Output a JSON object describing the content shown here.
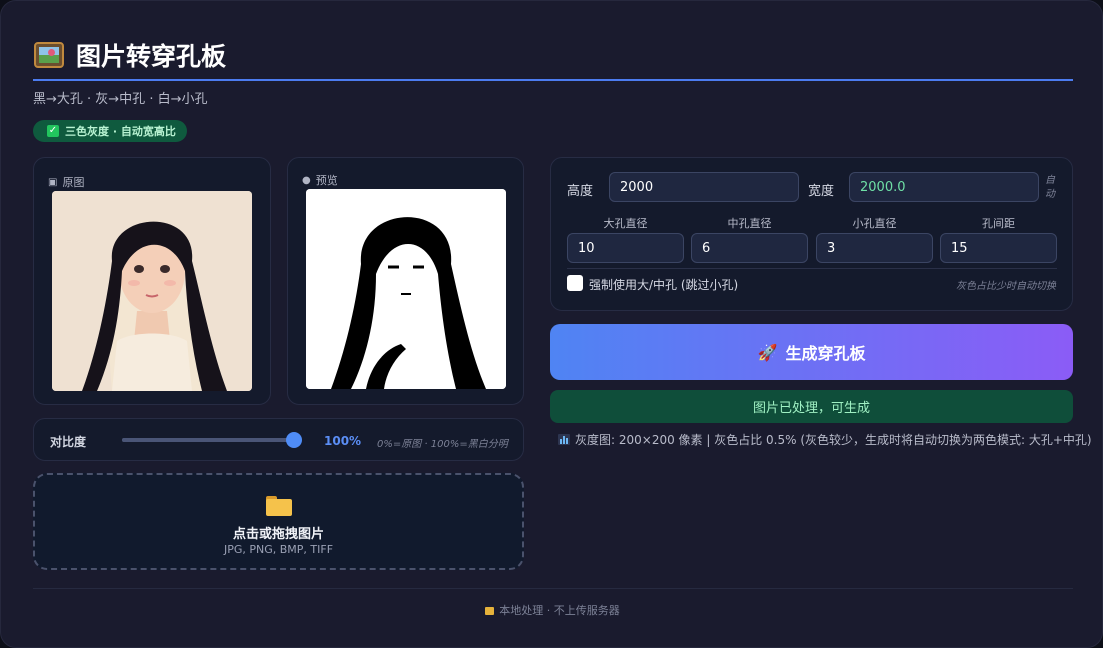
{
  "header": {
    "title": "图片转穿孔板",
    "subtitle": "黑→大孔 · 灰→中孔 · 白→小孔",
    "badge": "三色灰度 · 自动宽高比",
    "title_icon": "framed-picture-icon",
    "accent_color": "#4c7cf0"
  },
  "images": {
    "original_label": "原图",
    "original_icon": "camera-icon",
    "preview_label": "预览",
    "preview_icon": "eye-icon"
  },
  "contrast": {
    "label": "对比度",
    "value": 100,
    "value_text": "100%",
    "hint": "0%=原图 · 100%=黑白分明"
  },
  "upload": {
    "icon": "folder-icon",
    "title": "点击或拖拽图片",
    "formats": "JPG, PNG, BMP, TIFF"
  },
  "params": {
    "height_label": "高度",
    "height_value": "2000",
    "width_label": "宽度",
    "width_value": "2000.0",
    "auto_tag": "自动",
    "large_hole_label": "大孔直径",
    "large_hole_value": "10",
    "medium_hole_label": "中孔直径",
    "medium_hole_value": "6",
    "small_hole_label": "小孔直径",
    "small_hole_value": "3",
    "spacing_label": "孔间距",
    "spacing_value": "15",
    "force_label": "强制使用大/中孔 (跳过小孔)",
    "force_checked": false,
    "force_hint": "灰色占比少时自动切换"
  },
  "actions": {
    "generate_label": "生成穿孔板",
    "generate_icon": "rocket-icon",
    "gradient_start": "#4f84f3",
    "gradient_end": "#8b5cf6"
  },
  "status": {
    "message": "图片已处理，可生成",
    "stats": "灰度图: 200×200 像素 | 灰色占比 0.5% (灰色较少，生成时将自动切换为两色模式: 大孔+中孔)",
    "stats_icon": "bar-chart-icon",
    "status_color": "#0f4e3a"
  },
  "footer": {
    "text": "本地处理 · 不上传服务器",
    "icon": "lock-icon"
  }
}
